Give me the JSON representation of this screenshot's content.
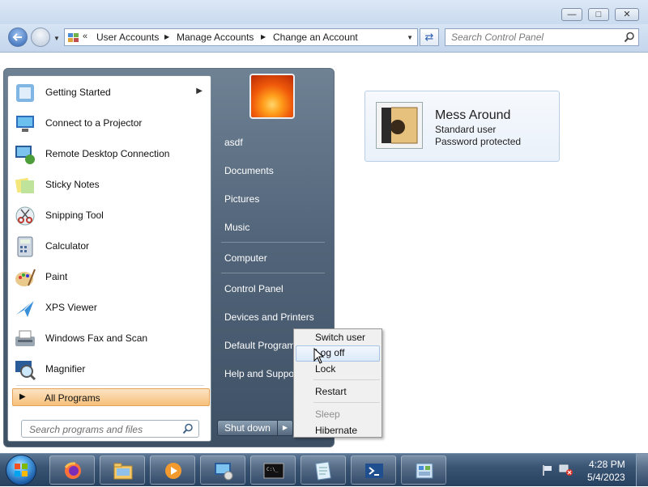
{
  "window": {
    "breadcrumbs": [
      "User Accounts",
      "Manage Accounts",
      "Change an Account"
    ],
    "search_placeholder": "Search Control Panel"
  },
  "account": {
    "name": "Mess Around",
    "type": "Standard user",
    "password_status": "Password protected"
  },
  "start_menu": {
    "programs": [
      {
        "label": "Getting Started",
        "icon": "getting-started-icon",
        "has_submenu": true
      },
      {
        "label": "Connect to a Projector",
        "icon": "projector-icon"
      },
      {
        "label": "Remote Desktop Connection",
        "icon": "remote-desktop-icon"
      },
      {
        "label": "Sticky Notes",
        "icon": "sticky-notes-icon"
      },
      {
        "label": "Snipping Tool",
        "icon": "snipping-tool-icon"
      },
      {
        "label": "Calculator",
        "icon": "calculator-icon"
      },
      {
        "label": "Paint",
        "icon": "paint-icon"
      },
      {
        "label": "XPS Viewer",
        "icon": "xps-viewer-icon"
      },
      {
        "label": "Windows Fax and Scan",
        "icon": "fax-scan-icon"
      },
      {
        "label": "Magnifier",
        "icon": "magnifier-icon"
      }
    ],
    "all_programs": "All Programs",
    "search_placeholder": "Search programs and files",
    "right_items": [
      "asdf",
      "Documents",
      "Pictures",
      "Music",
      "Computer",
      "Control Panel",
      "Devices and Printers",
      "Default Programs",
      "Help and Support"
    ],
    "shutdown_label": "Shut down"
  },
  "shutdown_menu": {
    "items": [
      {
        "label": "Switch user",
        "state": "normal"
      },
      {
        "label": "Log off",
        "state": "highlighted"
      },
      {
        "label": "Lock",
        "state": "normal"
      },
      {
        "label": "Restart",
        "state": "normal"
      },
      {
        "label": "Sleep",
        "state": "disabled"
      },
      {
        "label": "Hibernate",
        "state": "normal"
      }
    ]
  },
  "taskbar": {
    "apps": [
      "firefox-icon",
      "file-explorer-icon",
      "media-player-icon",
      "control-panel-screen-icon",
      "command-prompt-icon",
      "notepad-icon",
      "powershell-icon",
      "network-settings-icon"
    ],
    "time": "4:28 PM",
    "date": "5/4/2023"
  },
  "colors": {
    "all_programs_highlight": "#f6c07a",
    "start_menu_right": "#52657a",
    "taskbar": "#3a5474"
  }
}
